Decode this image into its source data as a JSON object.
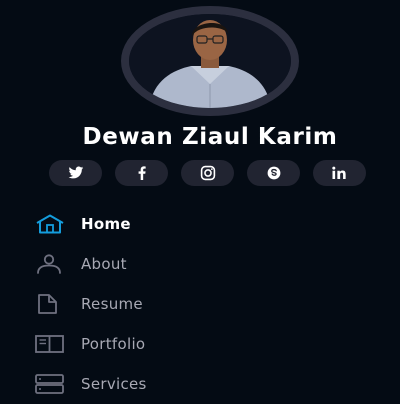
{
  "profile": {
    "name": "Dewan Ziaul Karim"
  },
  "social": [
    {
      "icon": "twitter-icon"
    },
    {
      "icon": "facebook-icon"
    },
    {
      "icon": "instagram-icon"
    },
    {
      "icon": "skype-icon"
    },
    {
      "icon": "linkedin-icon"
    }
  ],
  "nav": {
    "items": [
      {
        "label": "Home",
        "icon": "home-icon",
        "active": true
      },
      {
        "label": "About",
        "icon": "user-icon",
        "active": false
      },
      {
        "label": "Resume",
        "icon": "file-icon",
        "active": false
      },
      {
        "label": "Portfolio",
        "icon": "book-icon",
        "active": false
      },
      {
        "label": "Services",
        "icon": "server-icon",
        "active": false
      }
    ]
  },
  "colors": {
    "background": "#040b14",
    "accent": "#149ddd",
    "muted_text": "#a8a9b4",
    "social_bg": "#212431"
  }
}
